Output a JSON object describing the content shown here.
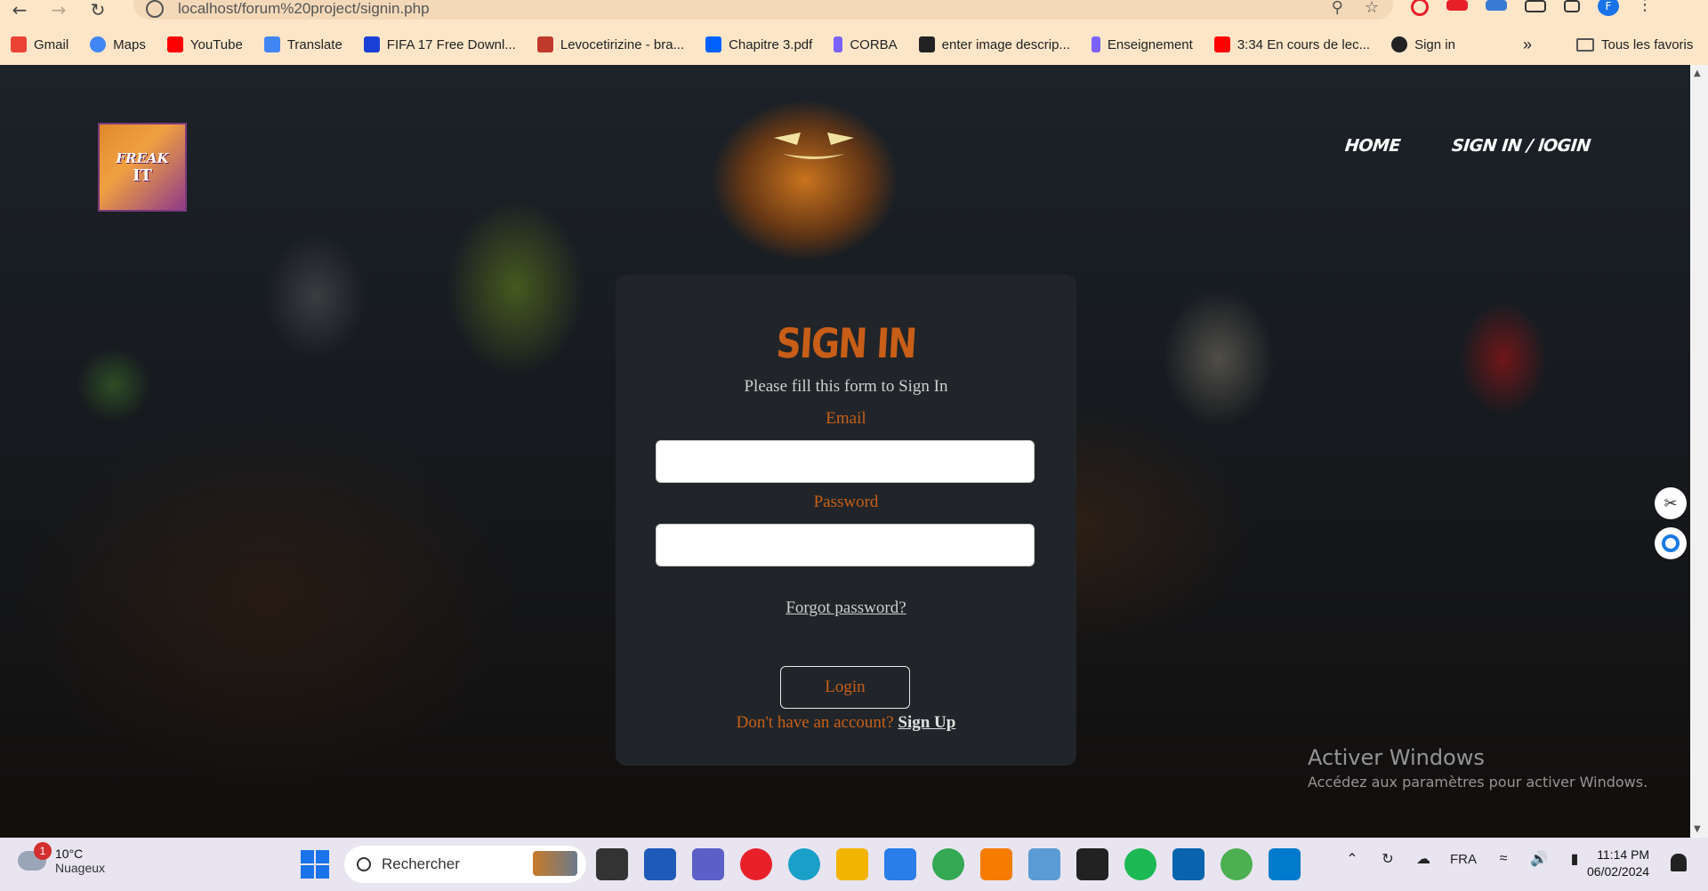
{
  "browser": {
    "url": "localhost/forum%20project/signin.php",
    "bookmarks": [
      {
        "label": "Gmail",
        "icon": "gmail-icon",
        "color": "#ea4335"
      },
      {
        "label": "Maps",
        "icon": "google-icon",
        "color": "#4285f4"
      },
      {
        "label": "YouTube",
        "icon": "youtube-icon",
        "color": "#ff0000"
      },
      {
        "label": "Translate",
        "icon": "translate-icon",
        "color": "#4285f4"
      },
      {
        "label": "FIFA 17 Free Downl...",
        "icon": "s-logo-icon",
        "color": "#1a3fd6"
      },
      {
        "label": "Levocetirizine - bra...",
        "icon": "pill-icon",
        "color": "#c0392b"
      },
      {
        "label": "Chapitre 3.pdf",
        "icon": "dropbox-icon",
        "color": "#0061ff"
      },
      {
        "label": "CORBA",
        "icon": "doc-icon",
        "color": "#7b61ff"
      },
      {
        "label": "enter image descrip...",
        "icon": "info-icon",
        "color": "#222222"
      },
      {
        "label": "Enseignement",
        "icon": "doc-icon",
        "color": "#7b61ff"
      },
      {
        "label": "3:34 En cours de lec...",
        "icon": "youtube-icon",
        "color": "#ff0000"
      },
      {
        "label": "Sign in",
        "icon": "github-icon",
        "color": "#222222"
      }
    ],
    "more_label": "»",
    "all_bookmarks_label": "Tous les favoris"
  },
  "site": {
    "logo_line1": "FREAK",
    "logo_line2": "IT",
    "nav": {
      "home": "HOME",
      "signin": "SIGN IN / lOGIN"
    }
  },
  "form": {
    "title": "SIGN IN",
    "subtitle": "Please fill this form to Sign In",
    "email_label": "Email",
    "password_label": "Password",
    "forgot_label": "Forgot password?",
    "login_label": "Login",
    "signup_prompt": "Don't have an account?",
    "signup_link": "Sign Up"
  },
  "watermark": {
    "title": "Activer Windows",
    "subtitle": "Accédez aux paramètres pour activer Windows."
  },
  "taskbar": {
    "weather_badge": "1",
    "weather_temp": "10°C",
    "weather_desc": "Nuageux",
    "search_placeholder": "Rechercher",
    "language": "FRA",
    "time": "11:14 PM",
    "date": "06/02/2024"
  },
  "colors": {
    "accent_orange": "#c85e17",
    "card_bg": "#212529",
    "browser_bar": "#fde6c8"
  }
}
